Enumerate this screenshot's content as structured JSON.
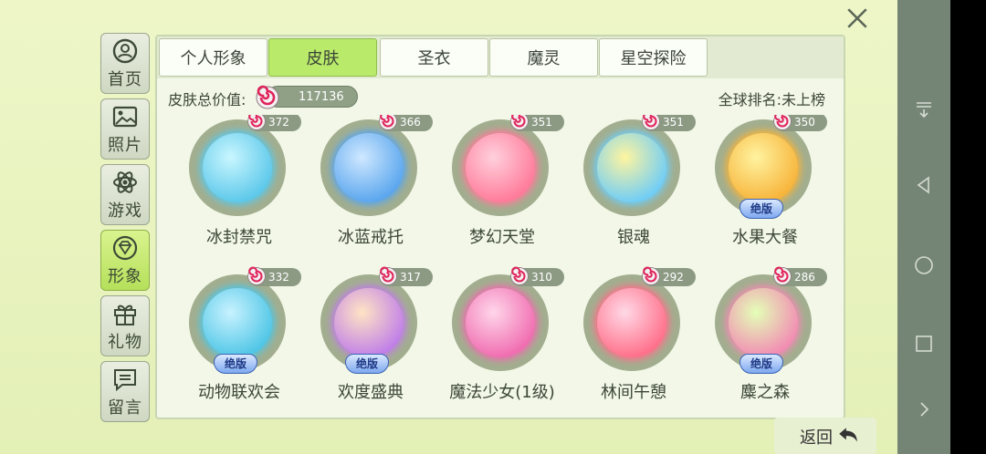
{
  "sidebar": {
    "items": [
      {
        "label": "首页",
        "icon": "person-icon"
      },
      {
        "label": "照片",
        "icon": "photo-icon"
      },
      {
        "label": "游戏",
        "icon": "atom-icon"
      },
      {
        "label": "形象",
        "icon": "gem-icon"
      },
      {
        "label": "礼物",
        "icon": "gift-icon"
      },
      {
        "label": "留言",
        "icon": "message-icon"
      }
    ],
    "active_index": 3
  },
  "tabs": [
    {
      "label": "个人形象"
    },
    {
      "label": "皮肤"
    },
    {
      "label": "圣衣"
    },
    {
      "label": "魔灵"
    },
    {
      "label": "星空探险"
    }
  ],
  "active_tab_index": 1,
  "summary": {
    "total_label": "皮肤总价值:",
    "total_value": "117136",
    "rank_text": "全球排名:未上榜"
  },
  "skins": [
    {
      "name": "冰封禁咒",
      "price": "372",
      "limited": "",
      "colors": [
        "#c9f6ff",
        "#5cc8ea"
      ]
    },
    {
      "name": "冰蓝戒托",
      "price": "366",
      "limited": "",
      "colors": [
        "#cfe8ff",
        "#5aa6ee"
      ]
    },
    {
      "name": "梦幻天堂",
      "price": "351",
      "limited": "",
      "colors": [
        "#ffd0dc",
        "#ff7a9a"
      ]
    },
    {
      "name": "银魂",
      "price": "351",
      "limited": "",
      "colors": [
        "#fff5a0",
        "#6fcdf7"
      ]
    },
    {
      "name": "水果大餐",
      "price": "350",
      "limited": "绝版",
      "colors": [
        "#fff3a0",
        "#f7b43a"
      ]
    },
    {
      "name": "动物联欢会",
      "price": "332",
      "limited": "绝版",
      "colors": [
        "#c8f2ff",
        "#4fc6e6"
      ]
    },
    {
      "name": "欢度盛典",
      "price": "317",
      "limited": "绝版",
      "colors": [
        "#ffe4c4",
        "#c07ee8"
      ]
    },
    {
      "name": "魔法少女(1级)",
      "price": "310",
      "limited": "",
      "colors": [
        "#ffd6ea",
        "#f06cb0"
      ]
    },
    {
      "name": "林间午憩",
      "price": "292",
      "limited": "",
      "colors": [
        "#ffd9e6",
        "#ff6f8a"
      ]
    },
    {
      "name": "麋之森",
      "price": "286",
      "limited": "绝版",
      "colors": [
        "#e4ffb7",
        "#f28bb3"
      ]
    }
  ],
  "back_label": "返回",
  "colors": {
    "active_green": "#b9ea6a",
    "candy_red": "#e0245a"
  }
}
